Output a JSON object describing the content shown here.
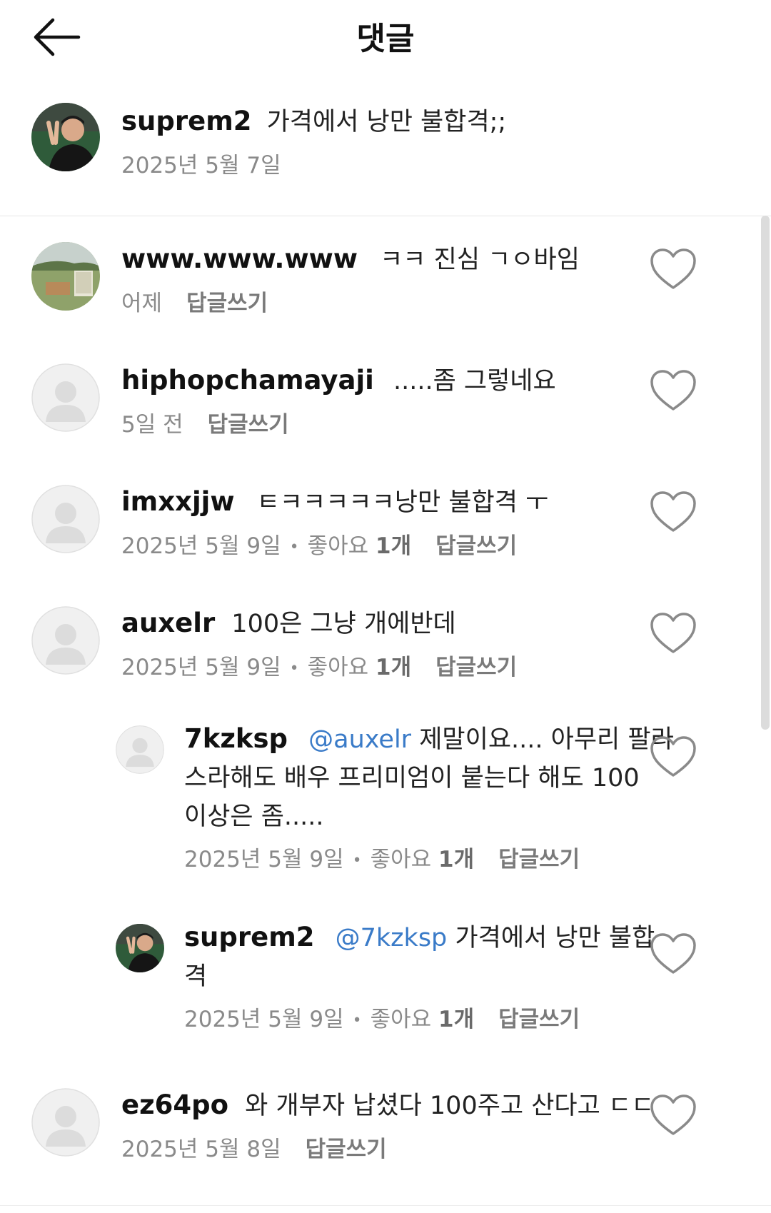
{
  "header": {
    "title": "댓글",
    "back_icon": "arrow-left-icon"
  },
  "caption": {
    "username": "suprem2",
    "text": "가격에서 낭만 불합격;;",
    "date": "2025년 5월 7일"
  },
  "reply_label": "답글쓰기",
  "likes_label": "좋아요",
  "likes_count": "1개",
  "comments": [
    {
      "username": "www.www.www",
      "text": "ㅋㅋ 진심 ㄱㅇ바임",
      "date": "어제"
    },
    {
      "username": "hiphopchamayaji",
      "text": ".....좀 그렇네요",
      "date": "5일 전"
    },
    {
      "username": "imxxjjw",
      "text": "ㅌㅋㅋㅋㅋㅋ낭만 불합격 ㅜ",
      "date": "2025년 5월 9일"
    },
    {
      "username": "auxelr",
      "text": "100은 그냥 개에반데",
      "date": "2025년 5월 9일"
    },
    {
      "username": "7kzksp",
      "mention": "@auxelr",
      "text_l1": "제말이요.... 아무리 팔라",
      "text_l2": "스라해도 배우 프리미엄이 붙는다 해도 100",
      "text_l3": "이상은 좀.....",
      "date": "2025년 5월 9일"
    },
    {
      "username": "suprem2",
      "mention": "@7kzksp",
      "text_l1": "가격에서 낭만 불합",
      "text_l2": "격",
      "date": "2025년 5월 9일"
    },
    {
      "username": "ez64po",
      "text": "와 개부자 납셨다 100주고 산다고 ㄷㄷ",
      "date": "2025년 5월 8일"
    }
  ]
}
